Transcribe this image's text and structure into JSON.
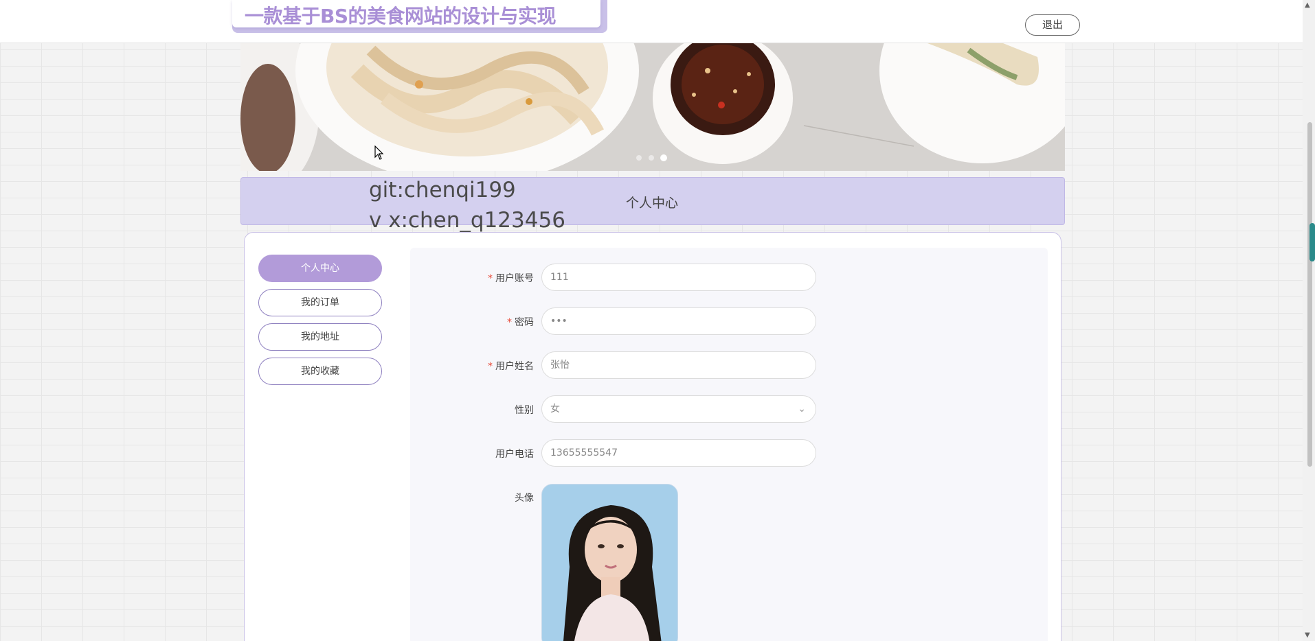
{
  "header": {
    "site_title": "一款基于BS的美食网站的设计与实现",
    "logout_label": "退出"
  },
  "banner": {
    "slide_count": 3,
    "active_slide": 3
  },
  "breadcrumb": {
    "git_line": "git:chenqi199",
    "wechat_line": "v x:chen_q123456",
    "page_title": "个人中心"
  },
  "sidebar": {
    "items": [
      {
        "label": "个人中心",
        "active": true
      },
      {
        "label": "我的订单",
        "active": false
      },
      {
        "label": "我的地址",
        "active": false
      },
      {
        "label": "我的收藏",
        "active": false
      }
    ]
  },
  "form": {
    "account": {
      "label": "用户账号",
      "required": true,
      "value": "111"
    },
    "password": {
      "label": "密码",
      "required": true,
      "value": "•••"
    },
    "name": {
      "label": "用户姓名",
      "required": true,
      "value": "张怡"
    },
    "gender": {
      "label": "性别",
      "required": false,
      "value": "女"
    },
    "phone": {
      "label": "用户电话",
      "required": false,
      "value": "13655555547"
    },
    "avatar": {
      "label": "头像"
    }
  },
  "colors": {
    "accent": "#b29bd9",
    "title": "#a98fd6",
    "strip": "#d4d0ef",
    "required": "#e74c3c"
  },
  "icons": [
    "chevron-down-icon",
    "cursor-icon",
    "avatar-image"
  ]
}
